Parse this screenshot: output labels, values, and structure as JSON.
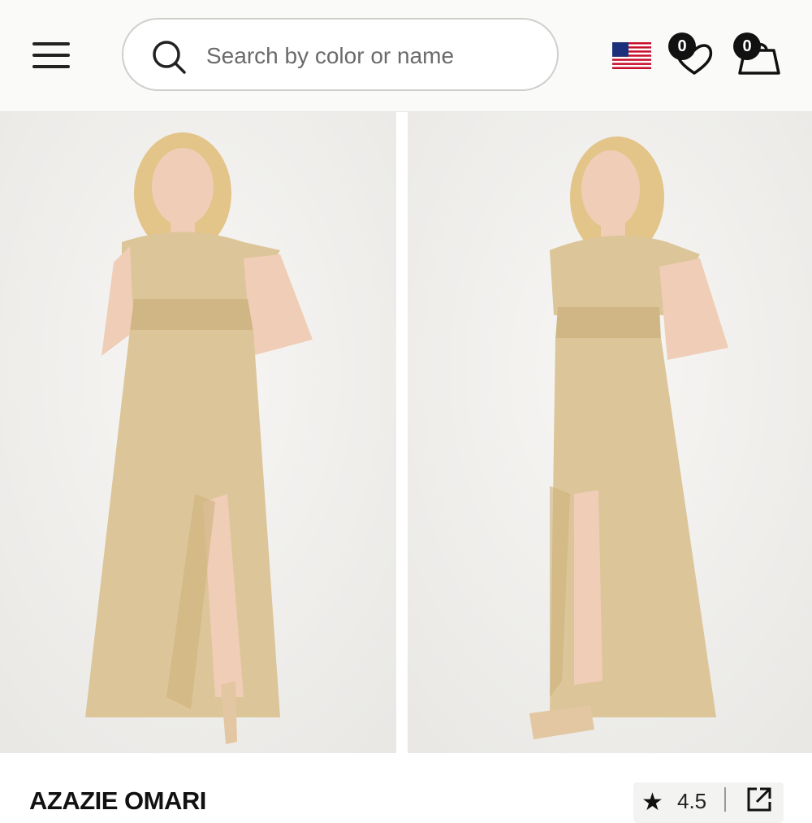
{
  "header": {
    "search": {
      "placeholder": "Search by color or name",
      "value": ""
    },
    "wishlist_count": "0",
    "cart_count": "0",
    "country_flag": "us-flag-icon"
  },
  "gallery": {
    "images": [
      {
        "alt": "Model wearing champagne chiffon V-neck flutter sleeve maxi dress, front view"
      },
      {
        "alt": "Model wearing champagne chiffon V-neck flutter sleeve maxi dress, angled view"
      }
    ],
    "dress_color": "#dcc598"
  },
  "product": {
    "name": "AZAZIE OMARI",
    "rating": "4.5",
    "star_glyph": "★"
  },
  "colors": {
    "header_bg": "#fafaf8",
    "photo_bg": "#f2f1ef",
    "dress": "#dcc598",
    "badge": "#111111"
  }
}
